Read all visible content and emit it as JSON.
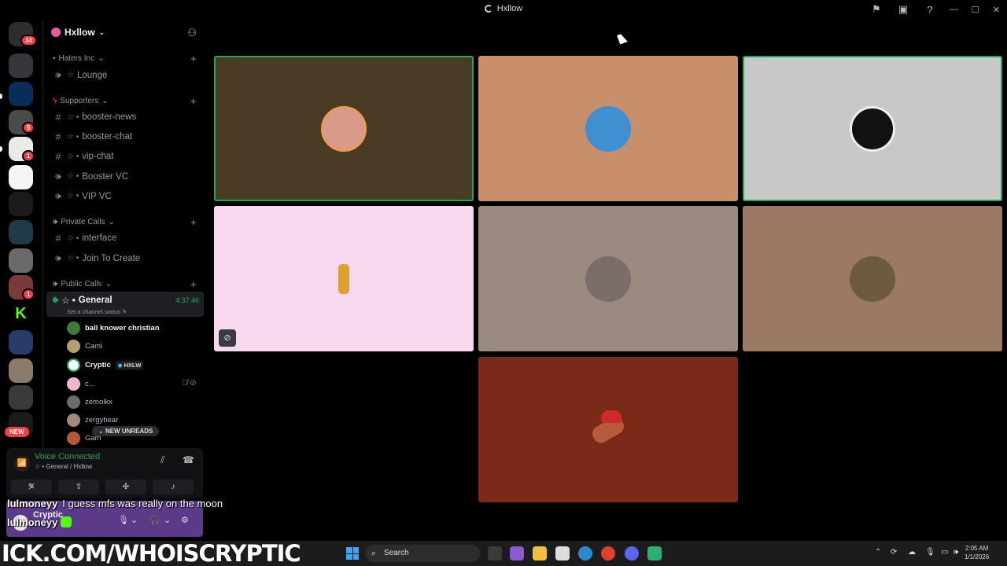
{
  "window": {
    "title": "Hxllow"
  },
  "server": {
    "name": "Hxllow"
  },
  "rail": {
    "home_badge": "34",
    "new_label": "NEW",
    "badges": [
      "5",
      "1",
      "1"
    ]
  },
  "categories": [
    {
      "name": "Haters Inc"
    },
    {
      "name": "Supporters"
    },
    {
      "name": "Private Calls"
    },
    {
      "name": "Public Calls"
    }
  ],
  "channels": [
    {
      "name": "Lounge",
      "type": "voice"
    },
    {
      "name": "booster-news",
      "type": "text"
    },
    {
      "name": "booster-chat",
      "type": "text"
    },
    {
      "name": "vip-chat",
      "type": "text"
    },
    {
      "name": "Booster VC",
      "type": "voice"
    },
    {
      "name": "VIP VC",
      "type": "voice"
    },
    {
      "name": "interface",
      "type": "text"
    },
    {
      "name": "Join To Create",
      "type": "voice"
    }
  ],
  "active_channel": {
    "name": "General",
    "time": "4:37:46",
    "status_placeholder": "Set a channel status"
  },
  "voice_users": [
    {
      "name": "ball knower christian",
      "color": "#3f7a3a",
      "bold": true
    },
    {
      "name": "Cami",
      "color": "#b4a06c",
      "bold": false
    },
    {
      "name": "Cryptic",
      "color": "#ffffff",
      "bold": true,
      "tag": "HXLW"
    },
    {
      "name": "c...",
      "color": "#f0b8d0",
      "bold": false
    },
    {
      "name": "zemolkx",
      "color": "#6b6b6b",
      "bold": false
    },
    {
      "name": "zergybear",
      "color": "#a18a7a",
      "bold": false
    },
    {
      "name": "Gam",
      "color": "#b35a3a",
      "bold": false
    }
  ],
  "new_unreads": "NEW UNREADS",
  "voice_panel": {
    "title": "Voice Connected",
    "subtitle": "General / Hxllow"
  },
  "user_panel": {
    "name": "Cryptic"
  },
  "overlay": {
    "chat_user": "lulmoneyy",
    "chat_message": "I guess mfs was really on the moon",
    "name_below": "lulmoneyy"
  },
  "tiles": [
    {
      "bg": "#4a3b24",
      "avatar": "#d99a8a",
      "speaking": true
    },
    {
      "bg": "#c78f6a",
      "avatar": "#3f8fd1",
      "speaking": false
    },
    {
      "bg": "#c8c8c8",
      "avatar": "#111111",
      "speaking": true
    },
    {
      "bg": "#f8d8ef",
      "avatar": "#e0a030",
      "speaking": false,
      "cam_off": true
    },
    {
      "bg": "#9a8a80",
      "avatar": "#7a6e6a",
      "speaking": false
    },
    {
      "bg": "#9a7a62",
      "avatar": "#6e5a3e",
      "speaking": false
    },
    {
      "bg": "#7a2a17",
      "avatar": "#b85a3a",
      "speaking": false
    }
  ],
  "taskbar": {
    "banner": "ICK.COM/WHOISCRYPTIC",
    "search_label": "Search",
    "time": "2:05 AM",
    "date": "1/1/2026"
  },
  "colors": {
    "green": "#23a55a",
    "red": "#f23f43",
    "panel": "#111214",
    "blurple": "#5865f2"
  }
}
